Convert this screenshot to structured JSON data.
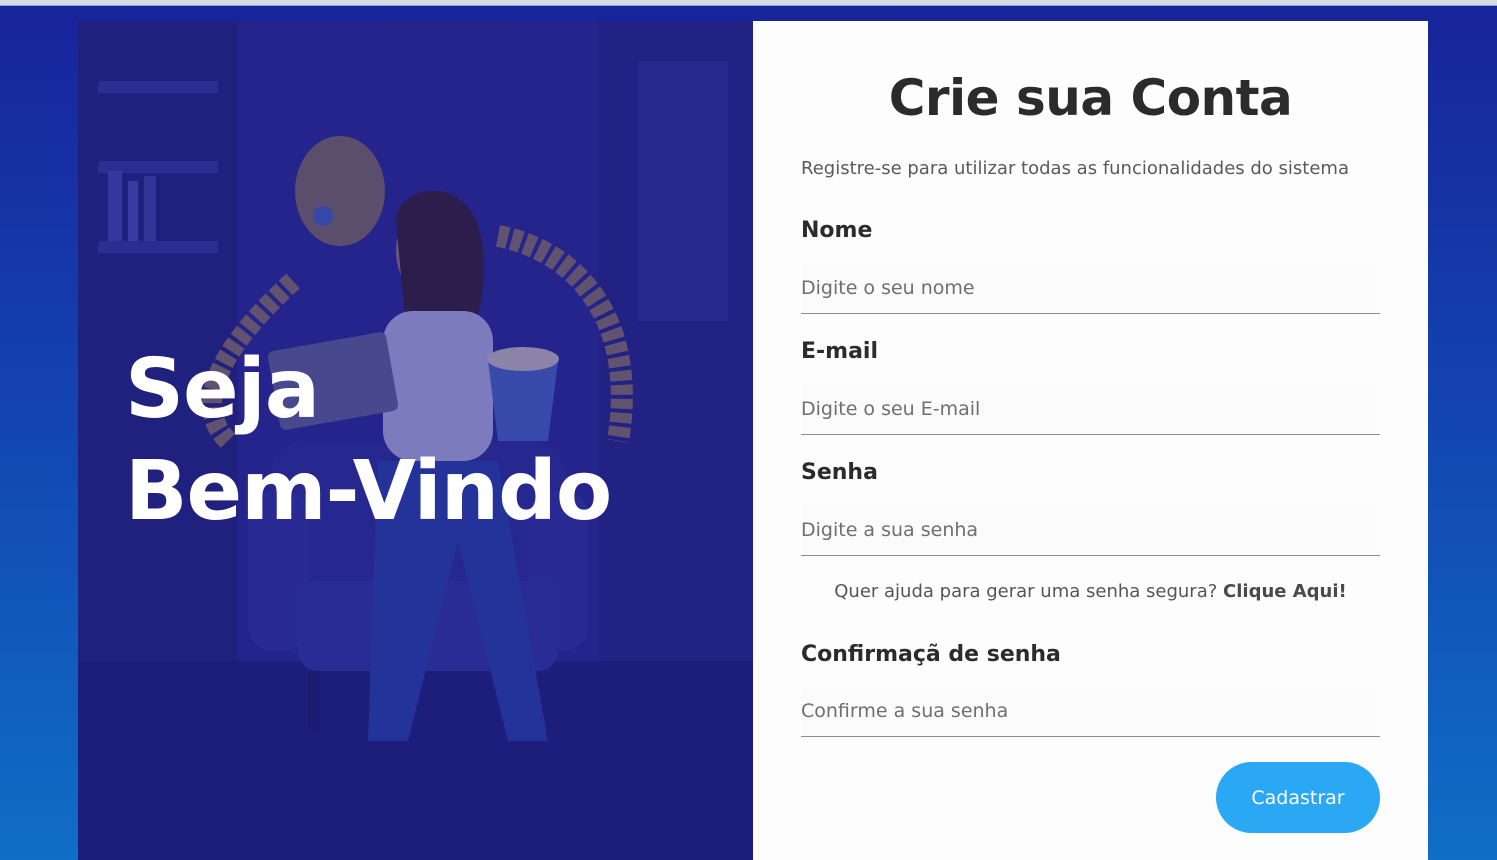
{
  "hero": {
    "title_line1": "Seja",
    "title_line2": "Bem-Vindo"
  },
  "form": {
    "title": "Crie sua Conta",
    "subtitle": "Registre-se para utilizar todas as funcionalidades do sistema",
    "fields": [
      {
        "label": "Nome",
        "placeholder": "Digite o seu nome"
      },
      {
        "label": "E-mail",
        "placeholder": "Digite o seu E-mail"
      },
      {
        "label": "Senha",
        "placeholder": "Digite a sua senha"
      },
      {
        "label": "Confirmaçã de senha",
        "placeholder": "Confirme a sua senha"
      }
    ],
    "help_text": "Quer ajuda para gerar uma senha segura?",
    "help_link": "Clique Aqui!",
    "submit_label": "Cadastrar"
  },
  "colors": {
    "background_top": "#18239a",
    "background_bottom": "#0f6ec6",
    "hero_overlay": "#1c188c",
    "button": "#2aa8f4",
    "title_text": "#2b2b2b"
  }
}
